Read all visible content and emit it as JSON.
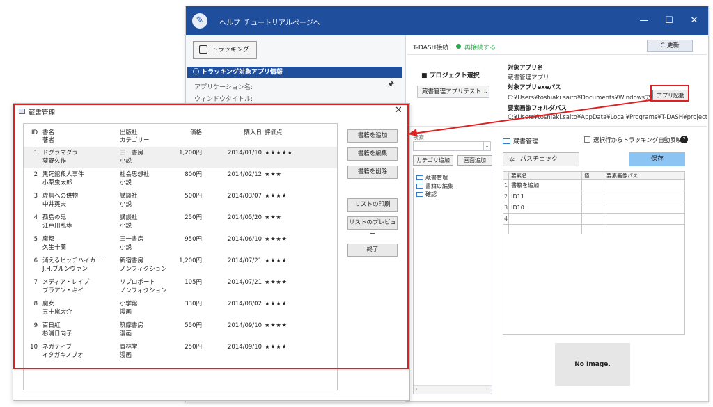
{
  "main_window": {
    "menu": [
      "ヘルプ",
      "チュートリアルページへ"
    ],
    "controls": [
      "—",
      "☐",
      "✕"
    ],
    "tracking_button": "トラッキング",
    "info_header": "ⓘ トラッキング対象アプリ情報",
    "app_name_label": "アプリケーション名:",
    "window_title_label": "ウィンドウタイトル:",
    "pin": "🖈"
  },
  "connection": {
    "label": "T-DASH接続",
    "status": "再接続する",
    "status_color": "#2fa84f",
    "refresh": "C 更新"
  },
  "project": {
    "label": "■ プロジェクト選択",
    "selected": "蔵書管理アプリテスト ⌄"
  },
  "target": {
    "app_name_key": "対象アプリ名",
    "app_name_val": "蔵書管理アプリ",
    "exe_key": "対象アプリexeパス",
    "exe_val": "C:¥Users¥toshiaki.saito¥Documents¥Windowsアプリ¥l",
    "launch_button": "アプリ起動",
    "image_folder_key": "要素画像フォルダパス",
    "image_folder_val": "C:¥Users¥toshiaki.saito¥AppData¥Local¥Programs¥T-DASH¥project"
  },
  "tree": {
    "search_label": "検索",
    "add_category": "カテゴリ追加",
    "add_screen": "画面追加",
    "items": [
      "蔵書管理",
      "書籍の編集",
      "確認"
    ]
  },
  "screen_panel": {
    "title": "蔵書管理",
    "auto_reflect": "選択行からトラッキング自動反映",
    "help": "?",
    "pass_check": "パスチェック",
    "pass_icon": "✲",
    "save": "保存",
    "columns": [
      "要素名",
      "値",
      "要素画像パス"
    ],
    "rows": [
      {
        "n": "1",
        "name": "書籍を追加"
      },
      {
        "n": "2",
        "name": "ID11"
      },
      {
        "n": "3",
        "name": "ID10"
      },
      {
        "n": "4",
        "name": ""
      },
      {
        "n": "",
        "name": ""
      }
    ],
    "no_image": "No Image."
  },
  "book_window": {
    "title": "蔵書管理",
    "close": "✕",
    "headers": {
      "id": "ID",
      "title": "書名",
      "author": "著者",
      "publisher": "出版社",
      "category": "カテゴリー",
      "price": "価格",
      "date": "購入日",
      "rating": "評価点"
    },
    "books": [
      {
        "id": "1",
        "title": "ドグラマグラ",
        "author": "夢野久作",
        "publisher": "三一書房",
        "category": "小説",
        "price": "1,200円",
        "date": "2014/01/10",
        "stars": "★★★★★"
      },
      {
        "id": "2",
        "title": "黒死館殺人事件",
        "author": "小栗虫太郎",
        "publisher": "社会思想社",
        "category": "小説",
        "price": "800円",
        "date": "2014/02/12",
        "stars": "★★★"
      },
      {
        "id": "3",
        "title": "虚無への供物",
        "author": "中井英夫",
        "publisher": "講談社",
        "category": "小説",
        "price": "500円",
        "date": "2014/03/07",
        "stars": "★★★★"
      },
      {
        "id": "4",
        "title": "孤島の鬼",
        "author": "江戸川乱歩",
        "publisher": "講談社",
        "category": "小説",
        "price": "250円",
        "date": "2014/05/20",
        "stars": "★★★"
      },
      {
        "id": "5",
        "title": "魔都",
        "author": "久生十蘭",
        "publisher": "三一書房",
        "category": "小説",
        "price": "950円",
        "date": "2014/06/10",
        "stars": "★★★★"
      },
      {
        "id": "6",
        "title": "消えるヒッチハイカー",
        "author": "J.H.ブルンヴァン",
        "publisher": "新宿書房",
        "category": "ノンフィクション",
        "price": "1,200円",
        "date": "2014/07/21",
        "stars": "★★★★"
      },
      {
        "id": "7",
        "title": "メディア・レイプ",
        "author": "ブラアン・キイ",
        "publisher": "リブロポート",
        "category": "ノンフィクション",
        "price": "105円",
        "date": "2014/07/21",
        "stars": "★★★★"
      },
      {
        "id": "8",
        "title": "魔女",
        "author": "五十嵐大介",
        "publisher": "小学館",
        "category": "漫画",
        "price": "330円",
        "date": "2014/08/02",
        "stars": "★★★★"
      },
      {
        "id": "9",
        "title": "百日紅",
        "author": "杉浦日向子",
        "publisher": "筑摩書房",
        "category": "漫画",
        "price": "550円",
        "date": "2014/09/10",
        "stars": "★★★★"
      },
      {
        "id": "10",
        "title": "ネガティブ",
        "author": "イタガキノブオ",
        "publisher": "青林堂",
        "category": "漫画",
        "price": "250円",
        "date": "2014/09/10",
        "stars": "★★★★"
      }
    ],
    "buttons": [
      "書籍を追加",
      "書籍を編集",
      "書籍を削除",
      "リストの印刷",
      "リストのプレビュー",
      "終了"
    ]
  },
  "annotation_color": "#e02020"
}
